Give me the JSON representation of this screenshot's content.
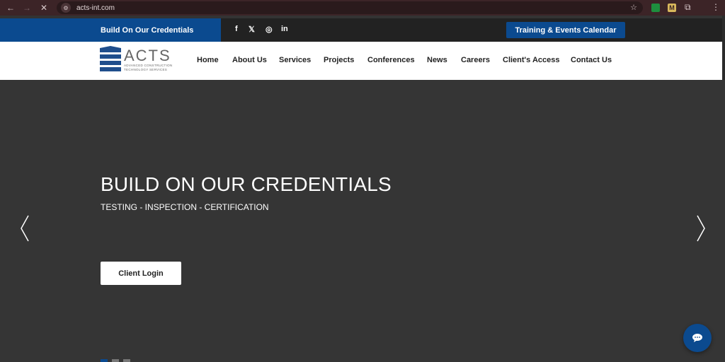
{
  "browser": {
    "url": "acts-int.com",
    "extension_gold_label": "M"
  },
  "topbar": {
    "tagline": "Build On Our Credentials",
    "social": [
      "f",
      "𝕏",
      "◎",
      "in"
    ],
    "calendar_button": "Training & Events Calendar"
  },
  "logo": {
    "word": "ACTS",
    "sub_line1": "ADVANCED CONSTRUCTION",
    "sub_line2": "TECHNOLOGY SERVICES"
  },
  "nav": {
    "items": [
      {
        "label": "Home"
      },
      {
        "label": "About Us"
      },
      {
        "label": "Services"
      },
      {
        "label": "Projects"
      },
      {
        "label": "Conferences"
      },
      {
        "label": "News"
      },
      {
        "label": "Careers"
      },
      {
        "label": "Client's Access"
      },
      {
        "label": "Contact Us"
      }
    ],
    "active": "Home"
  },
  "hero": {
    "title": "BUILD ON OUR CREDENTIALS",
    "subtitle": "TESTING - INSPECTION - CERTIFICATION",
    "button": "Client Login"
  },
  "colors": {
    "brand_blue": "#0b4a8f",
    "hero_bg": "#353535"
  },
  "icons": {
    "chat": "chat-bubble-icon",
    "prev": "chevron-left-icon",
    "next": "chevron-right-icon"
  }
}
